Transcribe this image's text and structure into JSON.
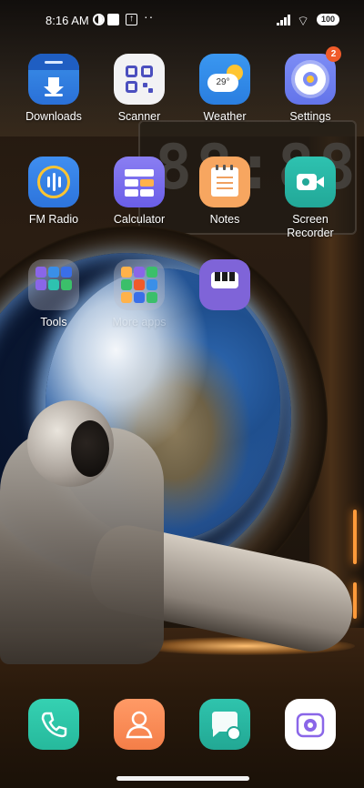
{
  "status_bar": {
    "time": "8:16 AM",
    "dots": "··",
    "battery": "100"
  },
  "apps": {
    "downloads": "Downloads",
    "scanner": "Scanner",
    "weather": "Weather",
    "weather_temp": "29°",
    "settings": "Settings",
    "settings_badge": "2",
    "fm_radio": "FM Radio",
    "calculator": "Calculator",
    "notes": "Notes",
    "screen_recorder_line1": "Screen",
    "screen_recorder_line2": "Recorder",
    "tools_folder": "Tools",
    "more_apps_folder": "More apps"
  },
  "wallpaper": {
    "clock_digits": "88:88"
  },
  "dock": {
    "apps": [
      "Phone",
      "Contacts",
      "Messages",
      "Camera"
    ]
  },
  "colors": {
    "settings_badge": "#f05b2a",
    "accent_blue": "#2a70d8"
  }
}
